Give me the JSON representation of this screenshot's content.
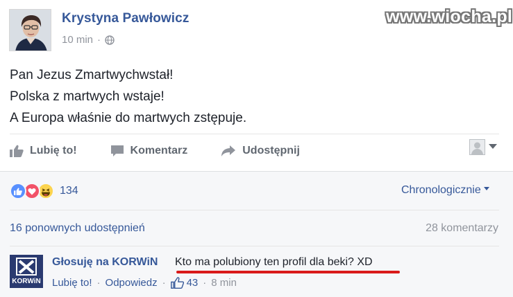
{
  "post": {
    "author": "Krystyna Pawłowicz",
    "time": "10 min",
    "privacy_icon": "globe-icon",
    "watermark": "www.wiocha.pl",
    "lines": [
      "Pan Jezus Zmartwychwstał!",
      "Polska z martwych wstaje!",
      "A Europa właśnie do martwych zstępuje."
    ]
  },
  "actions": {
    "like": "Lubię to!",
    "comment": "Komentarz",
    "share": "Udostępnij"
  },
  "reactions": {
    "count": "134",
    "types": [
      "like",
      "love",
      "haha"
    ],
    "sort_label": "Chronologicznie"
  },
  "stats": {
    "shares": "16 ponownych udostępnień",
    "comments": "28 komentarzy"
  },
  "comment": {
    "author": "Głosuję na KORWiN",
    "text": "Kto ma polubiony ten profil dla beki? XD",
    "avatar_text": "KORWiN",
    "like": "Lubię to!",
    "reply": "Odpowiedz",
    "likes": "43",
    "time": "8 min"
  },
  "colors": {
    "link": "#365899",
    "muted": "#90949c",
    "action": "#606770",
    "highlight": "#d91a1a"
  }
}
